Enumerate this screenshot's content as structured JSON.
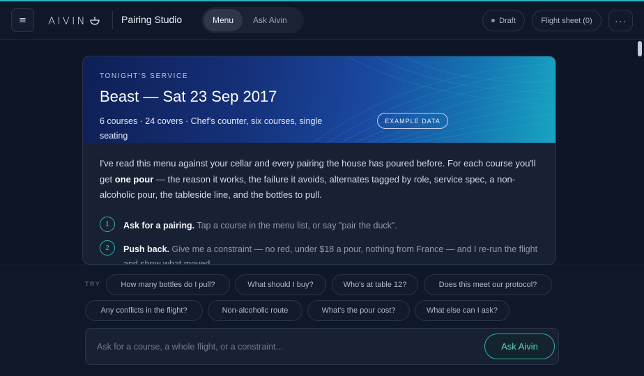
{
  "header": {
    "menu_icon": "hamburger-icon",
    "brand": "AIVIN",
    "brand_icon": "wine-bowl-icon",
    "app_title": "Pairing Studio",
    "tabs": [
      {
        "label": "Menu",
        "active": true
      },
      {
        "label": "Ask Aivin",
        "active": false
      }
    ],
    "status": "Draft",
    "flight_sheet": "Flight sheet (0)",
    "more": "···"
  },
  "card": {
    "eyebrow": "TONIGHT'S SERVICE",
    "title": "Beast — Sat 23 Sep 2017",
    "subtitle": "6 courses · 24 covers · Chef's counter, six courses, single seating",
    "badge": "EXAMPLE DATA",
    "intro_pre": "I've read this menu against your cellar and every pairing the house has poured before. For each course you'll get ",
    "intro_bold": "one pour",
    "intro_post": " — the reason it works, the failure it avoids, alternates tagged by role, service spec, a non-alcoholic pour, the tableside line, and the bottles to pull.",
    "steps": [
      {
        "num": "1",
        "title": "Ask for a pairing.",
        "text": " Tap a course in the menu list, or say \"pair the duck\"."
      },
      {
        "num": "2",
        "title": "Push back.",
        "text": " Give me a constraint — no red, under $18 a pour, nothing from France — and I re-run the flight and show what moved."
      }
    ]
  },
  "composer": {
    "try_label": "TRY",
    "suggestions": [
      "How many bottles do I pull?",
      "What should I buy?",
      "Who's at table 12?",
      "Does this meet our protocol?",
      "Any conflicts in the flight?",
      "Non-alcoholic route",
      "What's the pour cost?",
      "What else can I ask?"
    ],
    "placeholder": "Ask for a course, a whole flight, or a constraint...",
    "value": "",
    "submit": "Ask Aivin"
  },
  "colors": {
    "accent": "#2bb3a6",
    "background": "#0d1526",
    "card": "#172133"
  }
}
